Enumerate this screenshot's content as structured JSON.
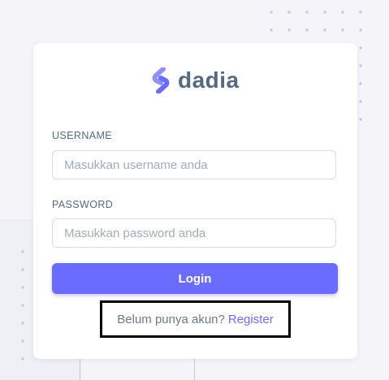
{
  "brand": {
    "name": "dadia",
    "accent_color": "#696cff",
    "logo_icon": "brand-s-logo-icon"
  },
  "form": {
    "username_label": "USERNAME",
    "username_placeholder": "Masukkan username anda",
    "username_value": "",
    "password_label": "PASSWORD",
    "password_placeholder": "Masukkan password anda",
    "password_value": "",
    "login_label": "Login"
  },
  "footer": {
    "prompt_text": "Belum punya akun?",
    "register_label": "Register"
  }
}
